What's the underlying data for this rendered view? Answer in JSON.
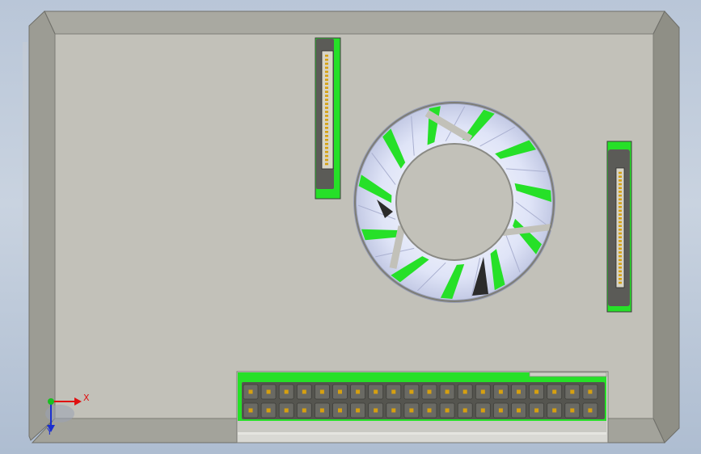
{
  "view": {
    "type": "3d-cad-viewport",
    "background_colors": [
      "#b9c6d8",
      "#aebdd1"
    ],
    "model_colors": {
      "board_face": "#c2c1b9",
      "bevel_top": "#a9a9a1",
      "bevel_side": "#8f8f86",
      "pcb_green": "#26e028",
      "connector_dark": "#5b5b57",
      "pin_gold": "#d6a010",
      "fan_blade": "#e6e9f8"
    }
  },
  "model": {
    "components": [
      "board-enclosure",
      "fan",
      "ribbon-connector-left",
      "ribbon-connector-right",
      "pin-header-2x20"
    ],
    "pin_header": {
      "rows": 2,
      "pins_per_row": 20
    },
    "ribbon_connector_left": {
      "pins": 28
    },
    "ribbon_connector_right": {
      "pins": 30
    },
    "fan": {
      "blades": 11
    }
  },
  "triad": {
    "x_label": "X",
    "y_label": "Y",
    "x_color": "#e01010",
    "y_color": "#1a2fd0",
    "origin_color": "#18c020"
  }
}
